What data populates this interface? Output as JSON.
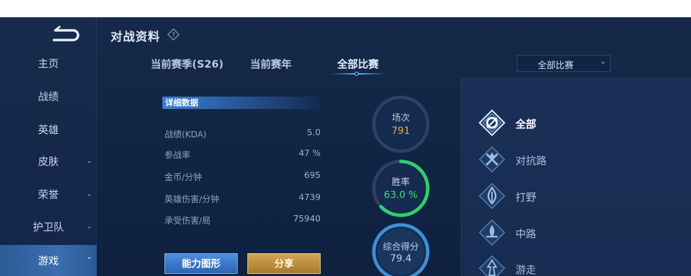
{
  "header": {
    "title": "对战资料"
  },
  "sidebar": {
    "items": [
      {
        "label": "主页",
        "chevron": ""
      },
      {
        "label": "战绩",
        "chevron": ""
      },
      {
        "label": "英雄",
        "chevron": ""
      },
      {
        "label": "皮肤",
        "chevron": "⌄"
      },
      {
        "label": "荣誉",
        "chevron": "⌄"
      },
      {
        "label": "护卫队",
        "chevron": "⌄"
      },
      {
        "label": "游戏",
        "chevron": "⌃"
      }
    ]
  },
  "tabs": [
    {
      "label": "当前赛季(S26)"
    },
    {
      "label": "当前赛年"
    },
    {
      "label": "全部比赛"
    }
  ],
  "dropdown": {
    "value": "全部比赛",
    "chevron": "⌄"
  },
  "stats": {
    "header": "详细数据",
    "rows": [
      {
        "label": "战绩(KDA)",
        "value": "5.0"
      },
      {
        "label": "参战率",
        "value": "47 %"
      },
      {
        "label": "金币/分钟",
        "value": "695"
      },
      {
        "label": "英雄伤害/分钟",
        "value": "4739"
      },
      {
        "label": "承受伤害/局",
        "value": "75940"
      }
    ]
  },
  "rings": {
    "matches": {
      "label": "场次",
      "value": "791"
    },
    "winrate": {
      "label": "胜率",
      "value": "63.0 %",
      "fraction": 0.63
    },
    "score": {
      "label": "综合得分",
      "value": "79.4"
    }
  },
  "buttons": {
    "ability": "能力图形",
    "share": "分享"
  },
  "roles": [
    {
      "label": "全部",
      "icon": "all-role-icon"
    },
    {
      "label": "对抗路",
      "icon": "clash-lane-icon"
    },
    {
      "label": "打野",
      "icon": "jungle-icon"
    },
    {
      "label": "中路",
      "icon": "mid-lane-icon"
    },
    {
      "label": "游走",
      "icon": "roam-icon"
    }
  ],
  "colors": {
    "accent_blue": "#5ac0ff",
    "matches_value": "#e8b04a",
    "winrate_value": "#3fe07a",
    "winrate_ring": "#2fce6e",
    "score_ring": "#3d8fd6"
  }
}
